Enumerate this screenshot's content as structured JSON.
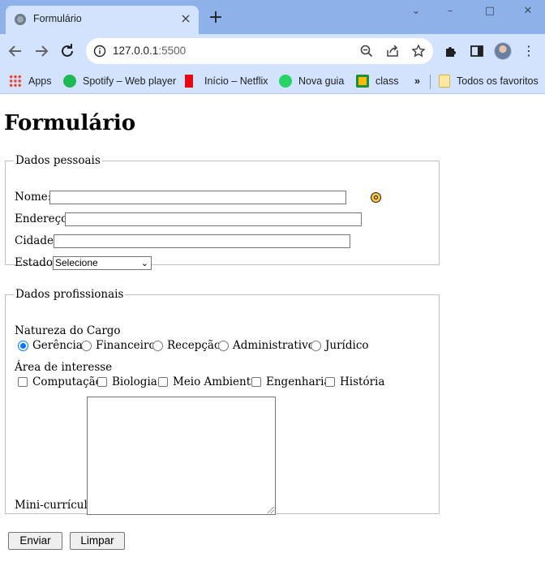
{
  "browser": {
    "tab": {
      "title": "Formulário"
    },
    "url": {
      "host": "127.0.0.1",
      "port": ":5500"
    },
    "bookmarks": [
      {
        "label": "Apps",
        "icon": "apps-grid-icon"
      },
      {
        "label": "Spotify – Web player",
        "icon": "spotify-icon"
      },
      {
        "label": "Início – Netflix",
        "icon": "netflix-icon"
      },
      {
        "label": "Nova guia",
        "icon": "whatsapp-icon"
      },
      {
        "label": "class",
        "icon": "google-classroom-icon"
      }
    ],
    "more_bookmarks": "»",
    "all_bookmarks": "Todos os favoritos"
  },
  "page": {
    "title": "Formulário",
    "personal": {
      "legend": "Dados pessoais",
      "nome_label": "Nome:",
      "endereco_label": "Endereço:",
      "cidade_label": "Cidade:",
      "estado_label": "Estado:",
      "estado_value": "Selecione"
    },
    "professional": {
      "legend": "Dados profissionais",
      "cargo_label": "Natureza do Cargo",
      "cargo_options": [
        "Gerência",
        "Financeiro",
        "Recepção",
        "Administrativo",
        "Jurídico"
      ],
      "cargo_selected": "Gerência",
      "interesse_label": "Área de interesse",
      "interesse_options": [
        "Computação",
        "Biologia",
        "Meio Ambiente",
        "Engenharia",
        "História"
      ],
      "curriculo_label": "Mini-currículo"
    },
    "buttons": {
      "submit": "Enviar",
      "reset": "Limpar"
    }
  },
  "colors": {
    "tab_strip": "#8fb1e9",
    "toolbar": "#d3e3fd",
    "radio_accent": "#0075ff"
  }
}
